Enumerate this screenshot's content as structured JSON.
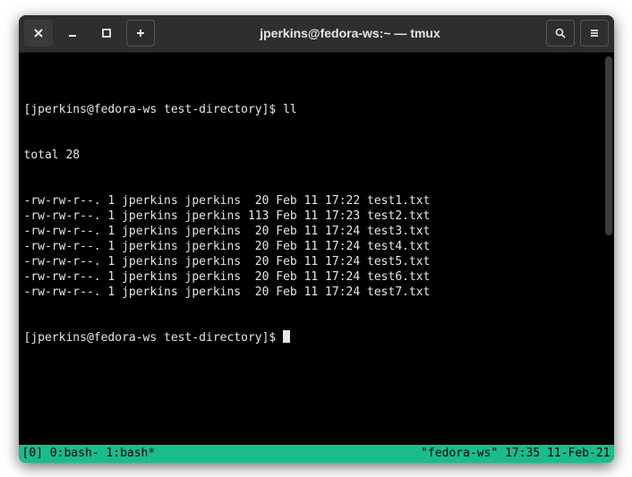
{
  "titlebar": {
    "title": "jperkins@fedora-ws:~ — tmux"
  },
  "prompt": {
    "text": "[jperkins@fedora-ws test-directory]$ "
  },
  "command": "ll",
  "output": {
    "total_line": "total 28",
    "entries": [
      {
        "perms": "-rw-rw-r--.",
        "links": "1",
        "owner": "jperkins",
        "group": "jperkins",
        "size": " 20",
        "date": "Feb 11 17:22",
        "name": "test1.txt"
      },
      {
        "perms": "-rw-rw-r--.",
        "links": "1",
        "owner": "jperkins",
        "group": "jperkins",
        "size": "113",
        "date": "Feb 11 17:23",
        "name": "test2.txt"
      },
      {
        "perms": "-rw-rw-r--.",
        "links": "1",
        "owner": "jperkins",
        "group": "jperkins",
        "size": " 20",
        "date": "Feb 11 17:24",
        "name": "test3.txt"
      },
      {
        "perms": "-rw-rw-r--.",
        "links": "1",
        "owner": "jperkins",
        "group": "jperkins",
        "size": " 20",
        "date": "Feb 11 17:24",
        "name": "test4.txt"
      },
      {
        "perms": "-rw-rw-r--.",
        "links": "1",
        "owner": "jperkins",
        "group": "jperkins",
        "size": " 20",
        "date": "Feb 11 17:24",
        "name": "test5.txt"
      },
      {
        "perms": "-rw-rw-r--.",
        "links": "1",
        "owner": "jperkins",
        "group": "jperkins",
        "size": " 20",
        "date": "Feb 11 17:24",
        "name": "test6.txt"
      },
      {
        "perms": "-rw-rw-r--.",
        "links": "1",
        "owner": "jperkins",
        "group": "jperkins",
        "size": " 20",
        "date": "Feb 11 17:24",
        "name": "test7.txt"
      }
    ]
  },
  "statusbar": {
    "left": "[0] 0:bash- 1:bash*",
    "right": "\"fedora-ws\" 17:35 11-Feb-21"
  }
}
